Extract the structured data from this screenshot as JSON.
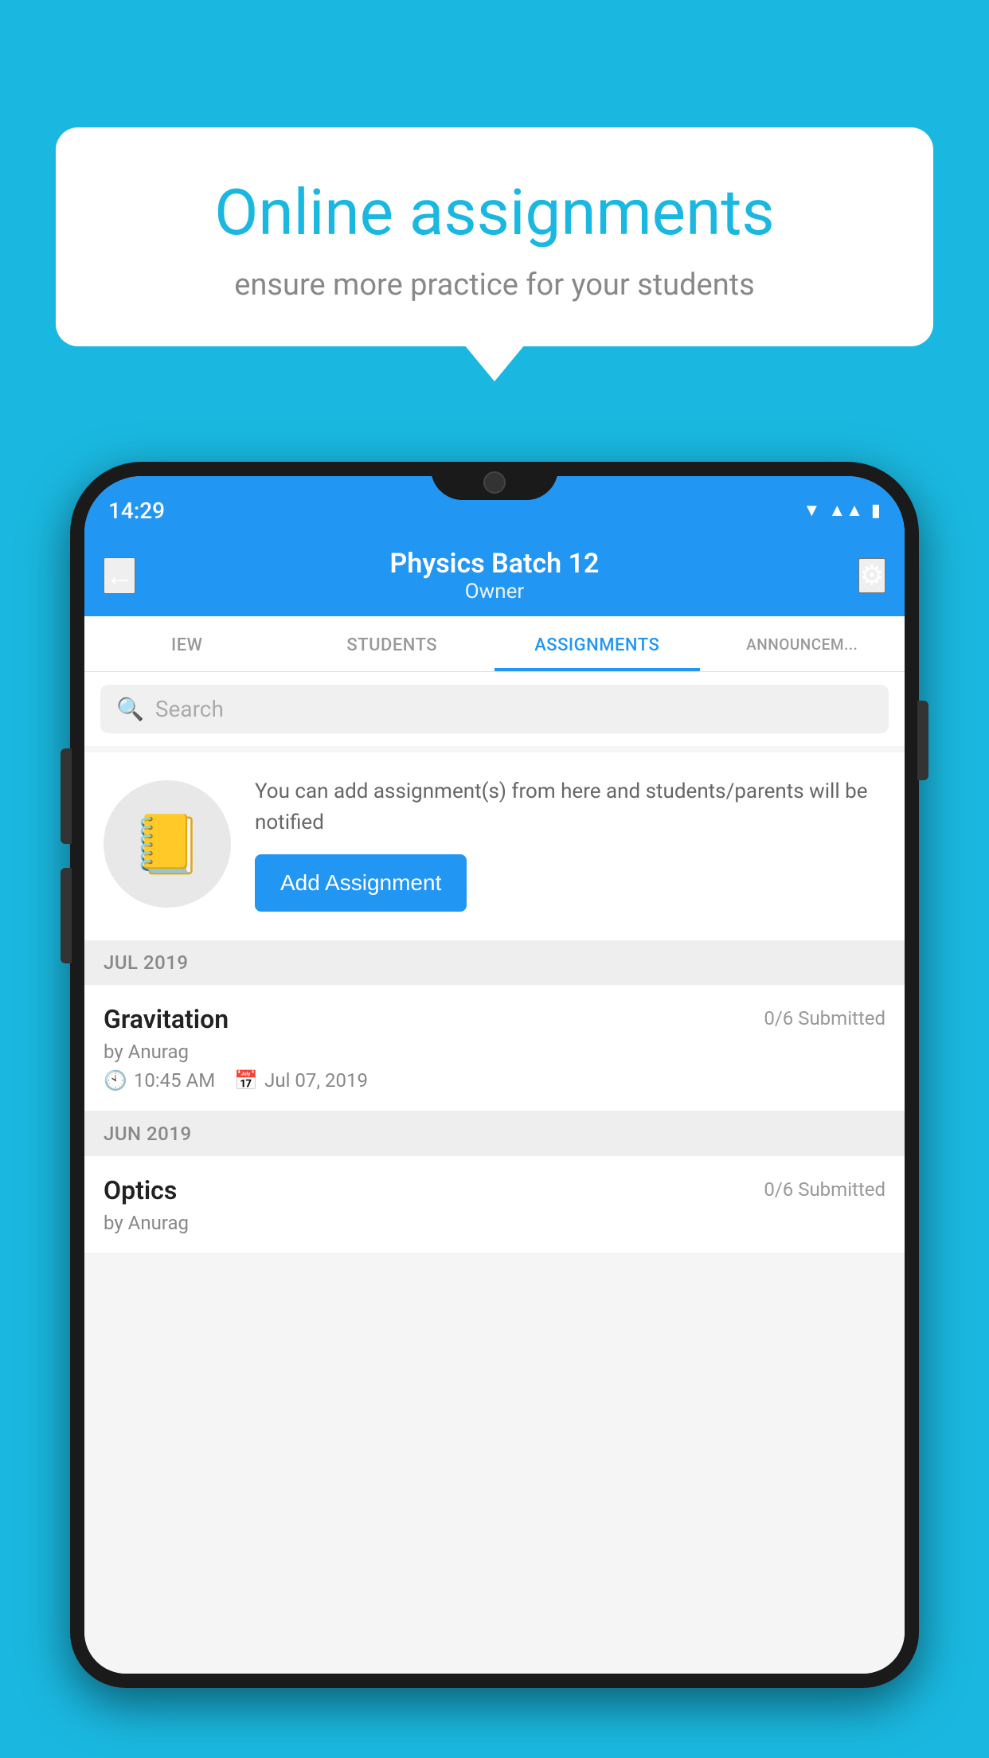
{
  "background_color": "#1ab8e0",
  "speech_bubble": {
    "title": "Online assignments",
    "subtitle": "ensure more practice for your students"
  },
  "phone": {
    "status_bar": {
      "time": "14:29",
      "icons": [
        "wifi",
        "signal",
        "battery"
      ]
    },
    "header": {
      "back_label": "←",
      "title": "Physics Batch 12",
      "subtitle": "Owner",
      "settings_label": "⚙"
    },
    "tabs": [
      {
        "label": "IEW",
        "active": false
      },
      {
        "label": "STUDENTS",
        "active": false
      },
      {
        "label": "ASSIGNMENTS",
        "active": true
      },
      {
        "label": "ANNOUNCEM...",
        "active": false
      }
    ],
    "search": {
      "placeholder": "Search"
    },
    "add_section": {
      "description": "You can add assignment(s) from here and students/parents will be notified",
      "button_label": "Add Assignment"
    },
    "assignment_groups": [
      {
        "month_label": "JUL 2019",
        "assignments": [
          {
            "name": "Gravitation",
            "submitted": "0/6 Submitted",
            "author": "by Anurag",
            "time": "10:45 AM",
            "date": "Jul 07, 2019"
          }
        ]
      },
      {
        "month_label": "JUN 2019",
        "assignments": [
          {
            "name": "Optics",
            "submitted": "0/6 Submitted",
            "author": "by Anurag",
            "time": "",
            "date": ""
          }
        ]
      }
    ]
  }
}
